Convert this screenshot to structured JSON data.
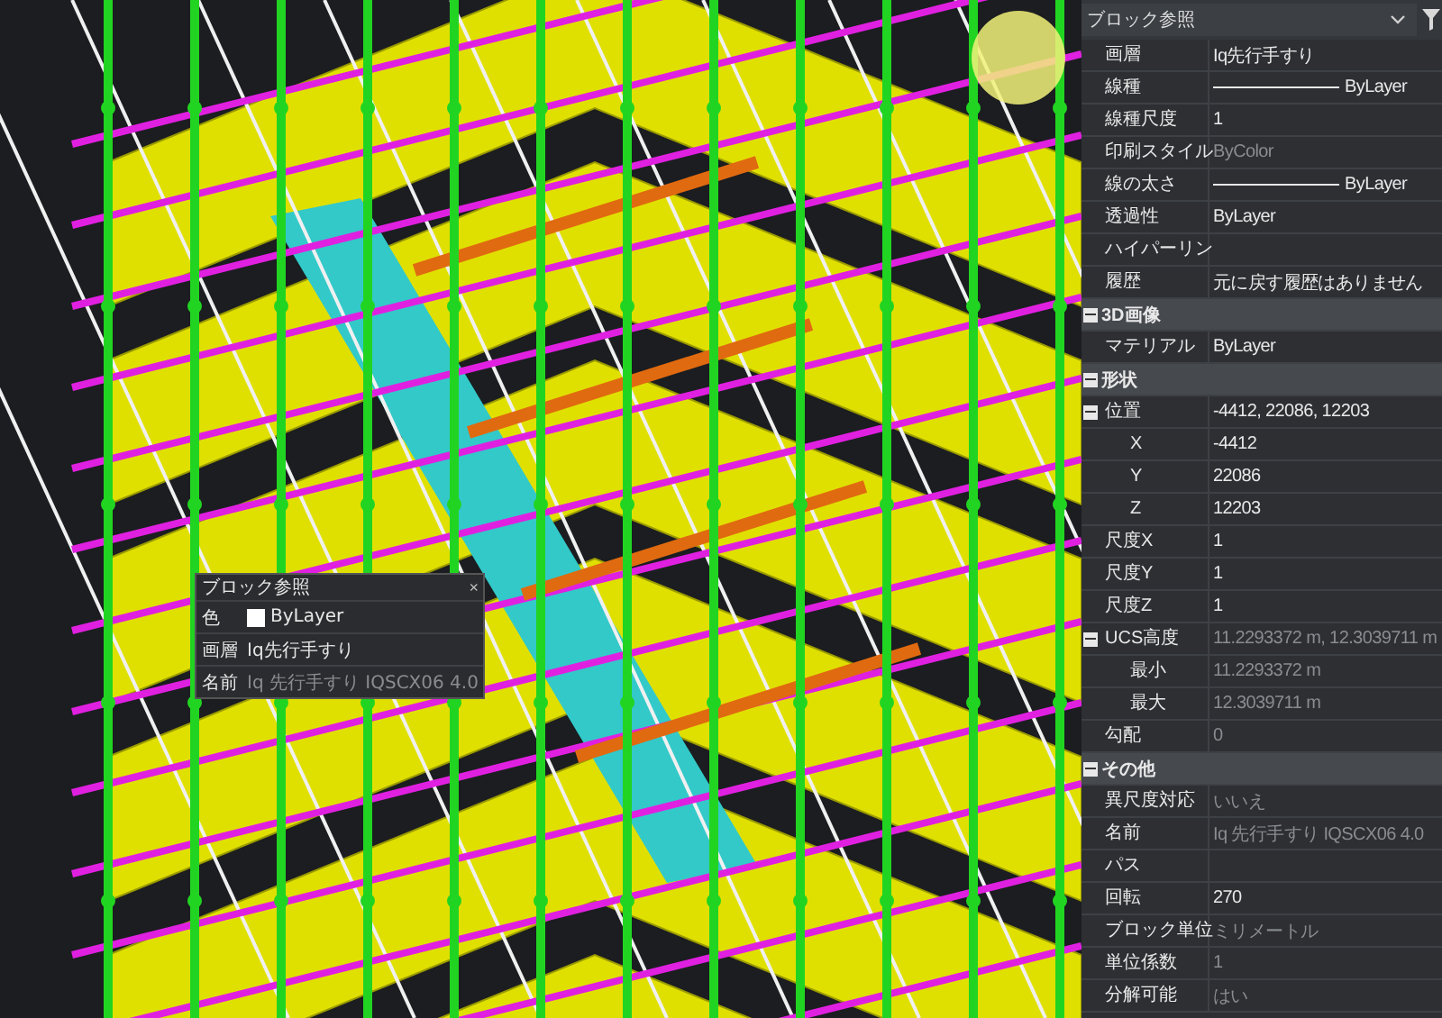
{
  "viewport": {
    "tooltip": {
      "title": "ブロック参照",
      "close": "×",
      "rows": [
        {
          "kind": "color",
          "label": "色",
          "value": "ByLayer",
          "color": "#ffffff"
        },
        {
          "kind": "text",
          "label": "画層",
          "value": "Iq先行手すり",
          "muted": false
        },
        {
          "kind": "text",
          "label": "名前",
          "value": "Iq 先行手すり IQSCX06 4.0",
          "muted": true
        }
      ]
    }
  },
  "panel": {
    "selector": "ブロック参照",
    "properties": [
      {
        "kind": "property",
        "label": "画層",
        "value": "Iq先行手すり",
        "muted": false
      },
      {
        "kind": "linetype",
        "label": "線種",
        "value": "ByLayer",
        "muted": false
      },
      {
        "kind": "property",
        "label": "線種尺度",
        "value": "1",
        "muted": false
      },
      {
        "kind": "property",
        "label": "印刷スタイル",
        "value": "ByColor",
        "muted": true
      },
      {
        "kind": "linetype",
        "label": "線の太さ",
        "value": "ByLayer",
        "muted": false
      },
      {
        "kind": "property",
        "label": "透過性",
        "value": "ByLayer",
        "muted": false
      },
      {
        "kind": "property",
        "label": "ハイパーリン"
      },
      {
        "kind": "property",
        "label": "履歴",
        "value": "元に戻す履歴はありません",
        "muted": false
      },
      {
        "kind": "section",
        "label": "3D画像",
        "expanded": true,
        "children": [
          {
            "kind": "property",
            "label": "マテリアル",
            "value": "ByLayer",
            "muted": false
          }
        ]
      },
      {
        "kind": "section",
        "label": "形状",
        "expanded": true,
        "children": [
          {
            "kind": "property",
            "label": "位置",
            "value": "-4412, 22086, 12203",
            "muted": false,
            "expanded": true,
            "children": [
              {
                "kind": "property",
                "label": "X",
                "value": "-4412",
                "muted": false
              },
              {
                "kind": "property",
                "label": "Y",
                "value": "22086",
                "muted": false
              },
              {
                "kind": "property",
                "label": "Z",
                "value": "12203",
                "muted": false
              }
            ]
          },
          {
            "kind": "property",
            "label": "尺度X",
            "value": "1",
            "muted": false
          },
          {
            "kind": "property",
            "label": "尺度Y",
            "value": "1",
            "muted": false
          },
          {
            "kind": "property",
            "label": "尺度Z",
            "value": "1",
            "muted": false
          },
          {
            "kind": "property",
            "label": "UCS高度",
            "value": "11.2293372 m, 12.3039711 m",
            "muted": true,
            "expanded": true,
            "children": [
              {
                "kind": "property",
                "label": "最小",
                "value": "11.2293372 m",
                "muted": true
              },
              {
                "kind": "property",
                "label": "最大",
                "value": "12.3039711 m",
                "muted": true
              }
            ]
          },
          {
            "kind": "property",
            "label": "勾配",
            "value": "0",
            "muted": true
          }
        ]
      },
      {
        "kind": "section",
        "label": "その他",
        "expanded": true,
        "children": [
          {
            "kind": "property",
            "label": "異尺度対応",
            "value": "いいえ",
            "muted": true
          },
          {
            "kind": "property",
            "label": "名前",
            "value": "Iq 先行手すり IQSCX06 4.0",
            "muted": true
          },
          {
            "kind": "property",
            "label": "パス"
          },
          {
            "kind": "property",
            "label": "回転",
            "value": "270",
            "muted": false
          },
          {
            "kind": "property",
            "label": "ブロック単位",
            "value": "ミリメートル",
            "muted": true
          },
          {
            "kind": "property",
            "label": "単位係数",
            "value": "1",
            "muted": true
          },
          {
            "kind": "property",
            "label": "分解可能",
            "value": "はい",
            "muted": true
          }
        ]
      }
    ]
  }
}
